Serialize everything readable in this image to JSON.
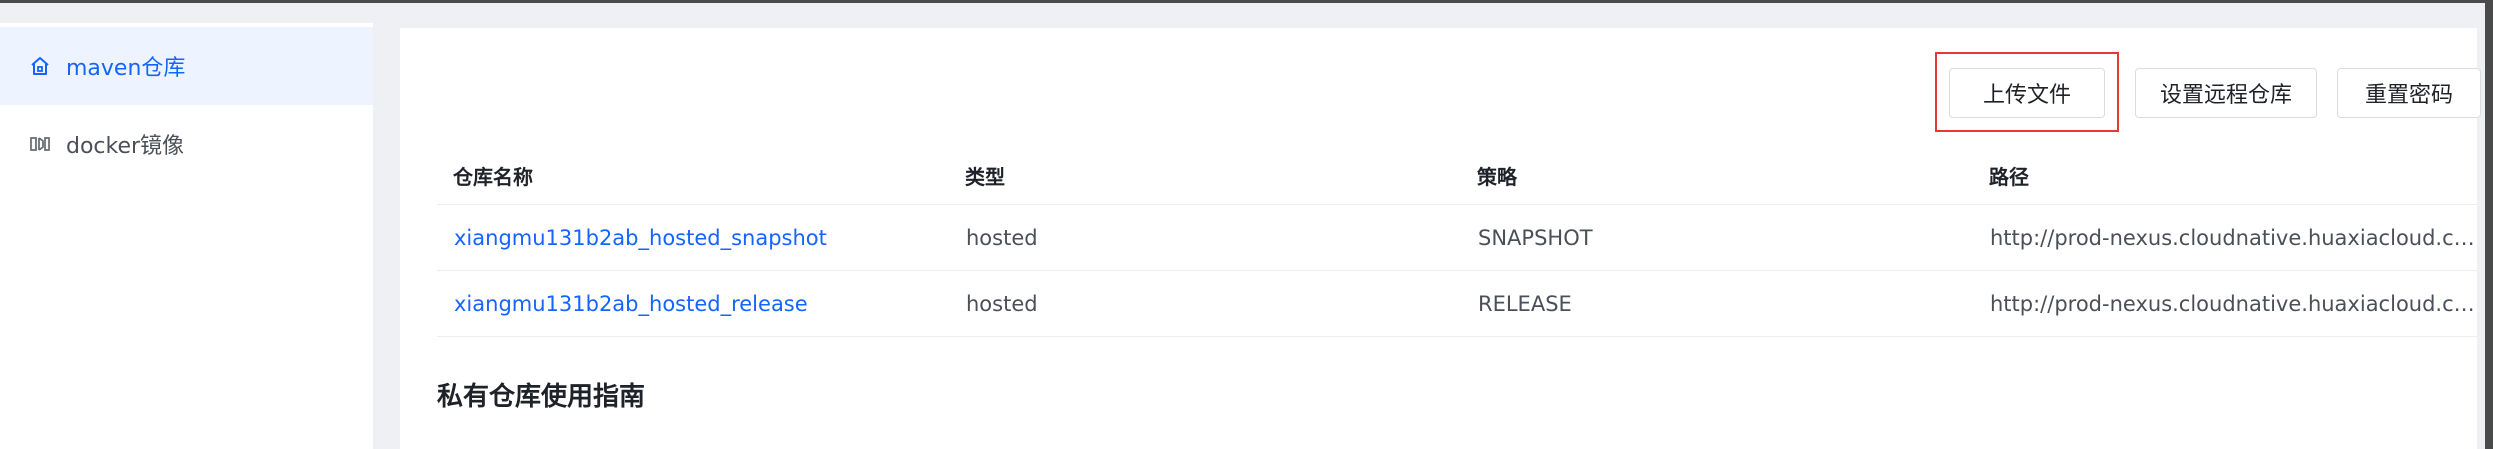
{
  "sidebar": {
    "items": [
      {
        "label": "maven仓库",
        "icon": "home-icon",
        "active": true
      },
      {
        "label": "docker镜像",
        "icon": "docker-icon",
        "active": false
      }
    ]
  },
  "toolbar": {
    "upload_label": "上传文件",
    "remote_label": "设置远程仓库",
    "reset_label": "重置密码"
  },
  "table": {
    "columns": [
      "仓库名称",
      "类型",
      "策略",
      "路径"
    ],
    "rows": [
      {
        "name": "xiangmu131b2ab_hosted_snapshot",
        "type": "hosted",
        "policy": "SNAPSHOT",
        "path": "http://prod-nexus.cloudnative.huaxiacloud.co..."
      },
      {
        "name": "xiangmu131b2ab_hosted_release",
        "type": "hosted",
        "policy": "RELEASE",
        "path": "http://prod-nexus.cloudnative.huaxiacloud.co..."
      }
    ]
  },
  "guide": {
    "title": "私有仓库使用指南"
  },
  "colors": {
    "accent": "#1664ff",
    "highlight": "#e53935"
  }
}
